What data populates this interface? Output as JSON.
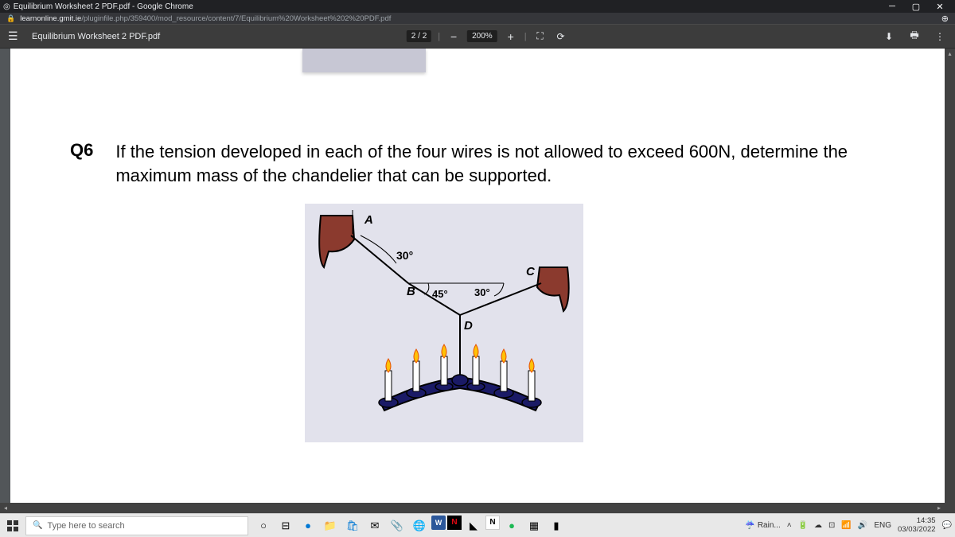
{
  "browser": {
    "window_title": "Equilibrium Worksheet 2 PDF.pdf - Google Chrome",
    "url_domain": "learnonline.gmit.ie",
    "url_path": "/pluginfile.php/359400/mod_resource/content/7/Equilibrium%20Worksheet%202%20PDF.pdf"
  },
  "pdfviewer": {
    "filename": "Equilibrium Worksheet 2 PDF.pdf",
    "page_current": "2",
    "page_sep": "/",
    "page_total": "2",
    "zoom": "200%"
  },
  "document": {
    "question_number": "Q6",
    "question_text": "If the tension developed in each of the four wires is not allowed to exceed 600N, determine the maximum mass of the chandelier that can be supported.",
    "diagram": {
      "label_A": "A",
      "label_B": "B",
      "label_C": "C",
      "label_D": "D",
      "angle_AB": "30°",
      "angle_BD_left": "45°",
      "angle_CD_right": "30°"
    }
  },
  "taskbar": {
    "search_placeholder": "Type here to search",
    "weather_text": "Rain...",
    "lang": "ENG",
    "time": "14:35",
    "date": "03/03/2022"
  }
}
